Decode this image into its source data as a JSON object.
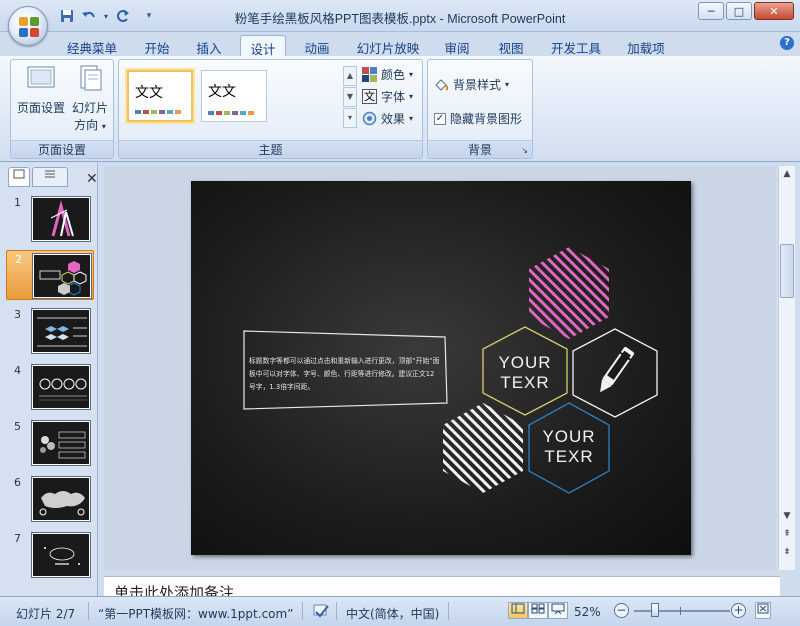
{
  "window": {
    "title": "粉笔手绘黑板风格PPT图表模板.pptx - Microsoft PowerPoint",
    "controls": {
      "minimize": "─",
      "maximize": "□",
      "close": "✕"
    }
  },
  "tabs": [
    {
      "label": "经典菜单"
    },
    {
      "label": "开始"
    },
    {
      "label": "插入"
    },
    {
      "label": "设计"
    },
    {
      "label": "动画"
    },
    {
      "label": "幻灯片放映"
    },
    {
      "label": "审阅"
    },
    {
      "label": "视图"
    },
    {
      "label": "开发工具"
    },
    {
      "label": "加载项"
    }
  ],
  "ribbon": {
    "page_setup": {
      "page_setup_label": "页面设置",
      "orientation_label_1": "幻灯片",
      "orientation_label_2": "方向",
      "group_label": "页面设置"
    },
    "themes": {
      "thumb1_text": "文文",
      "thumb2_text": "文文",
      "colors_label": "颜色",
      "fonts_label": "字体",
      "fonts_icon_text": "文",
      "effects_label": "效果",
      "group_label": "主题"
    },
    "background": {
      "styles_label": "背景样式",
      "hide_graphics_label": "隐藏背景图形",
      "hide_graphics_checked": true,
      "group_label": "背景"
    }
  },
  "slides_panel": {
    "selected": 2,
    "thumbnails": [
      {
        "num": "1"
      },
      {
        "num": "2"
      },
      {
        "num": "3"
      },
      {
        "num": "4"
      },
      {
        "num": "5"
      },
      {
        "num": "6"
      },
      {
        "num": "7"
      }
    ]
  },
  "slide": {
    "body_text": "标题数字等都可以通过点击和重新输入进行更改，顶部“开始”面板中可以对字体、字号、颜色、行距等进行修改。建议正文12号字，1.3倍字间距。",
    "hex1_line1": "YOUR",
    "hex1_line2": "TEXR",
    "hex2_line1": "YOUR",
    "hex2_line2": "TEXR"
  },
  "notes": {
    "placeholder": "单击此处添加备注"
  },
  "statusbar": {
    "slide_info": "幻灯片 2/7",
    "theme_name": "“第一PPT模板网：www.1ppt.com”",
    "language": "中文(简体，中国)",
    "zoom": "52%",
    "zoom_percent": 52
  },
  "colors": {
    "pink": "#e266c4",
    "yellow_hex": "#d8cf6a",
    "blue_hex": "#2a7fc8",
    "chalk": "#f2f2f2"
  }
}
